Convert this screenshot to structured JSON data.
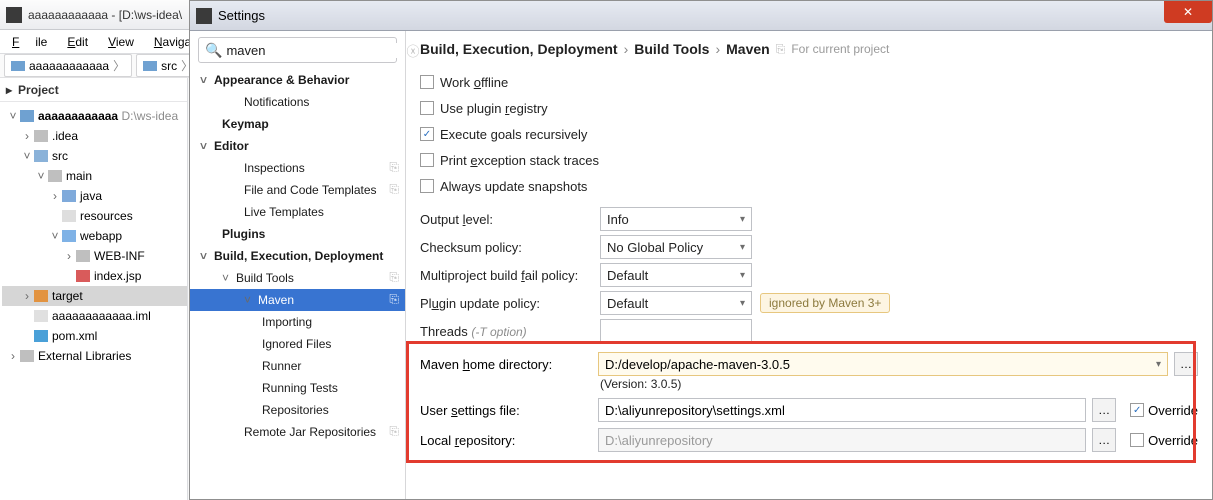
{
  "main": {
    "title": "aaaaaaaaaaaa - [D:\\ws-idea\\",
    "menu": {
      "file": "File",
      "edit": "Edit",
      "view": "View",
      "navigate": "Navigate"
    },
    "breadcrumb": {
      "a": "aaaaaaaaaaaa",
      "b": "src"
    },
    "project_label": "Project"
  },
  "tree": {
    "root": "aaaaaaaaaaaa",
    "root_hint": "D:\\ws-idea",
    "idea": ".idea",
    "src": "src",
    "main": "main",
    "java": "java",
    "resources": "resources",
    "webapp": "webapp",
    "webinf": "WEB-INF",
    "indexjsp": "index.jsp",
    "target": "target",
    "iml": "aaaaaaaaaaaa.iml",
    "pom": "pom.xml",
    "extlib": "External Libraries"
  },
  "settings": {
    "title": "Settings",
    "search_value": "maven",
    "tree": {
      "appearance": "Appearance & Behavior",
      "notifications": "Notifications",
      "keymap": "Keymap",
      "editor": "Editor",
      "inspections": "Inspections",
      "fact": "File and Code Templates",
      "live_tpl": "Live Templates",
      "plugins": "Plugins",
      "bed": "Build, Execution, Deployment",
      "build_tools": "Build Tools",
      "maven": "Maven",
      "importing": "Importing",
      "ignored": "Ignored Files",
      "runner": "Runner",
      "running_tests": "Running Tests",
      "repos": "Repositories",
      "remote_repos": "Remote Jar Repositories"
    },
    "crumb": {
      "a": "Build, Execution, Deployment",
      "b": "Build Tools",
      "c": "Maven",
      "hint": "For current project"
    },
    "checks": {
      "offline": "Work offline",
      "plugin_registry": "Use plugin registry",
      "exec_goals": "Execute goals recursively",
      "print_exc": "Print exception stack traces",
      "always_update": "Always update snapshots"
    },
    "form": {
      "output_level": "Output level:",
      "output_level_val": "Info",
      "checksum": "Checksum policy:",
      "checksum_val": "No Global Policy",
      "multiproj": "Multiproject build fail policy:",
      "multiproj_val": "Default",
      "plugin_upd": "Plugin update policy:",
      "plugin_upd_val": "Default",
      "plugin_upd_warn": "ignored by Maven 3+",
      "threads": "Threads",
      "threads_hint": "(-T option)",
      "mvn_home": "Maven home directory:",
      "mvn_home_val": "D:/develop/apache-maven-3.0.5",
      "mvn_ver": "(Version: 3.0.5)",
      "user_settings": "User settings file:",
      "user_settings_val": "D:\\aliyunrepository\\settings.xml",
      "local_repo": "Local repository:",
      "local_repo_val": "D:\\aliyunrepository",
      "override": "Override"
    }
  }
}
